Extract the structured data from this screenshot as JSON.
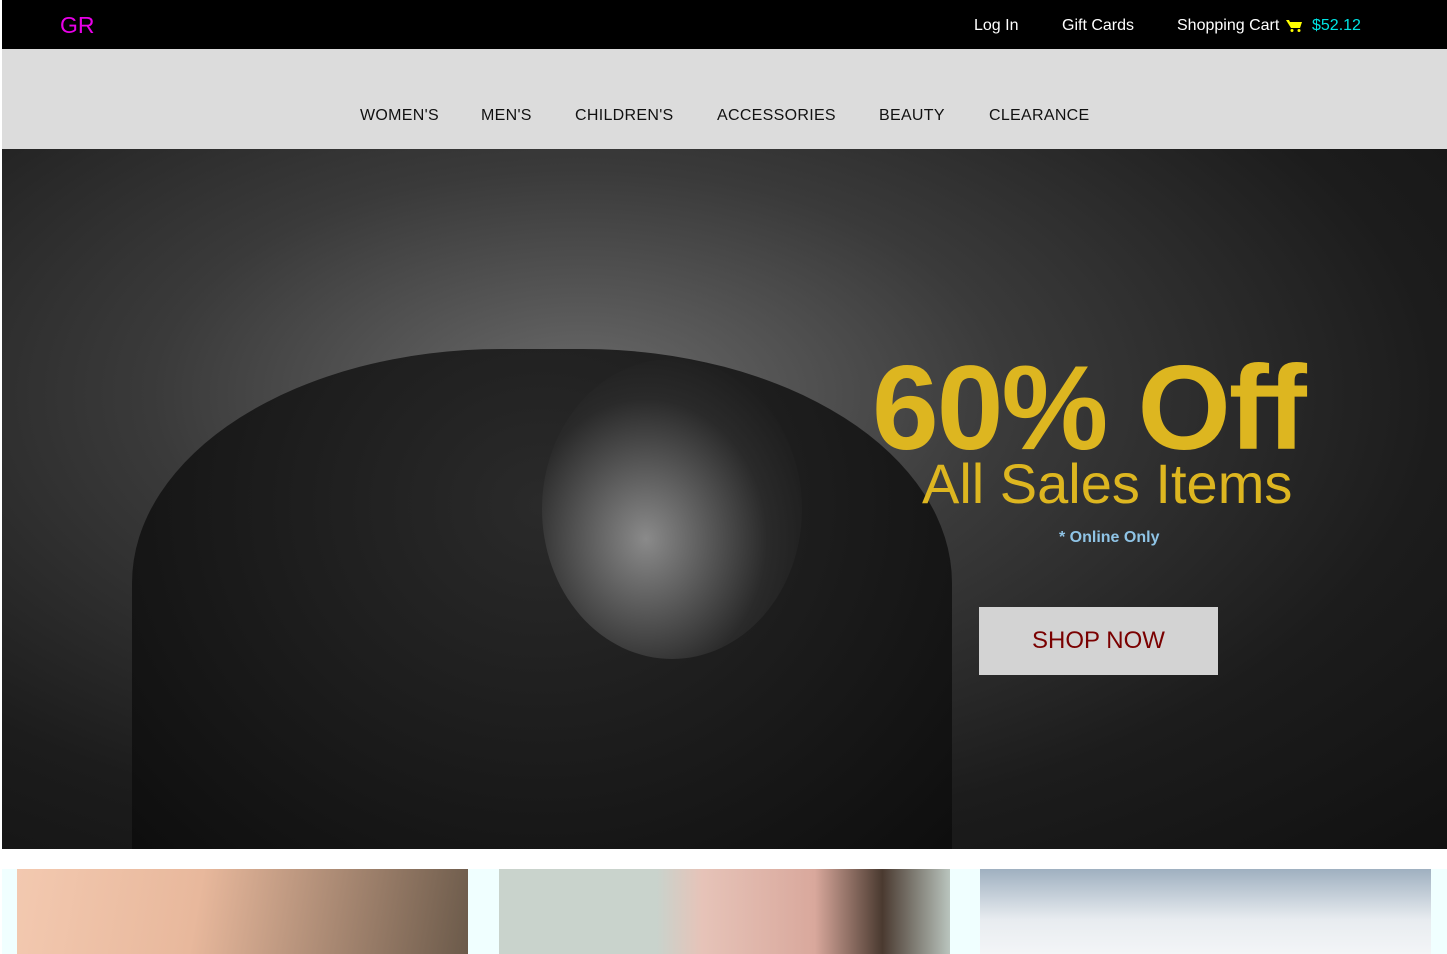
{
  "header": {
    "logo": "GR",
    "links": [
      "Log In",
      "Gift Cards",
      "Shopping Cart"
    ],
    "cart_total": "$52.12"
  },
  "nav": {
    "items": [
      "WOMEN'S",
      "MEN'S",
      "CHILDREN'S",
      "ACCESSORIES",
      "BEAUTY",
      "CLEARANCE"
    ]
  },
  "hero": {
    "headline": "60% Off",
    "subhead": "All Sales Items",
    "note": "* Online Only",
    "cta": "SHOP NOW"
  },
  "colors": {
    "accent": "#ddb620",
    "logo": "#e800e8",
    "price": "#00e5e5",
    "cta_text": "#7a0000"
  }
}
